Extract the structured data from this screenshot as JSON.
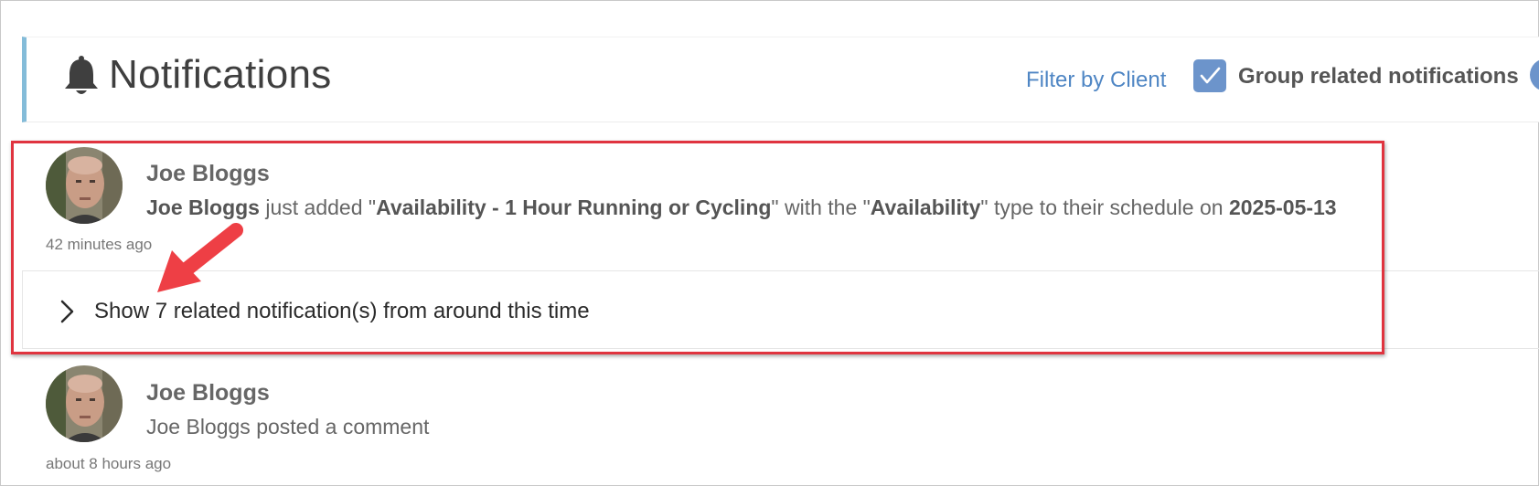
{
  "header": {
    "title": "Notifications",
    "bell_icon": "bell-icon",
    "filter_label": "Filter by Client",
    "group_related": {
      "label": "Group related notifications",
      "checked": true
    }
  },
  "notifications": [
    {
      "name": "Joe Bloggs",
      "text_parts": [
        {
          "bold": true,
          "text": "Joe Bloggs"
        },
        {
          "bold": false,
          "text": " just added \""
        },
        {
          "bold": true,
          "text": "Availability - 1 Hour Running or Cycling"
        },
        {
          "bold": false,
          "text": "\" with the \""
        },
        {
          "bold": true,
          "text": "Availability"
        },
        {
          "bold": false,
          "text": "\" type to their schedule on "
        },
        {
          "bold": true,
          "text": "2025-05-13"
        }
      ],
      "time": "42 minutes ago",
      "related": {
        "label": "Show 7 related notification(s) from around this time",
        "icon": "chevron-right-icon"
      }
    },
    {
      "name": "Joe Bloggs",
      "text": "Joe Bloggs posted a comment",
      "time": "about 8 hours ago"
    }
  ],
  "annotation": {
    "highlight_color": "#e0343f",
    "arrow_color": "#ee3f45"
  },
  "colors": {
    "accent_bar": "#84bcd9",
    "link": "#4f86c4",
    "checkbox": "#6c94cb"
  }
}
